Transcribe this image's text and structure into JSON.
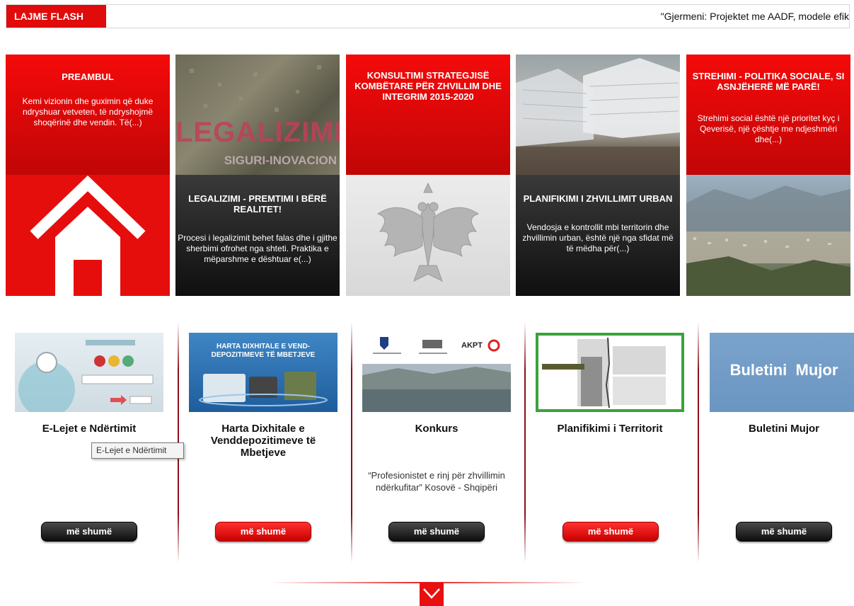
{
  "flash": {
    "label": "LAJME FLASH",
    "ticker": "\"Gjermeni: Projektet me AADF, modele efik"
  },
  "tiles": [
    {
      "title": "PREAMBUL",
      "text": "Kemi vizionin dhe guximin që duke ndryshuar vetveten, të ndryshojmë shoqërinë dhe vendin. Të(...)"
    },
    {
      "title": "LEGALIZIMI - PREMTIMI I BËRË REALITET!",
      "text": "Procesi i legalizimit behet falas dhe i gjithe sherbimi ofrohet nga shteti. Praktika e mëparshme e dështuar e(...)",
      "image_text": "LEGALIZIMI",
      "image_subtext": "SIGURI-INOVACION"
    },
    {
      "title": "KONSULTIMI STRATEGJISË KOMBËTARE PËR ZHVILLIM DHE INTEGRIM 2015-2020"
    },
    {
      "title": "PLANIFIKIMI I ZHVILLIMIT URBAN",
      "text": "Vendosja e kontrollit mbi territorin dhe zhvillimin urban, është një nga sfidat më të mëdha për(...)"
    },
    {
      "title": "STREHIMI - POLITIKA SOCIALE, SI ASNJËHERË MË PARË!",
      "text": "Strehimi social është një prioritet kyç i Qeverisë, një  çështje me ndjeshmëri dhe(...)"
    }
  ],
  "cards": [
    {
      "title": "E-Lejet e Ndërtimit",
      "text": "",
      "button": "më shumë"
    },
    {
      "title": "Harta Dixhitale e Venddepozitimeve të Mbetjeve",
      "text": "",
      "button": "më shumë",
      "image_text": "HARTA DIXHITALE E VEND-DEPOZITIMEVE TË MBETJEVE"
    },
    {
      "title": "Konkurs",
      "text": "“Profesionistet e rinj për zhvillimin ndërkufitar” Kosovë - Shqipëri",
      "button": "më shumë",
      "image_text": "AKPT"
    },
    {
      "title": "Planifikimi i Territorit",
      "text": "",
      "button": "më shumë"
    },
    {
      "title": "Buletini Mujor",
      "text": "",
      "button": "më shumë",
      "image_text": "Buletini  Mujor"
    }
  ],
  "tooltip": "E-Lejet e Ndërtimit",
  "colors": {
    "accent": "#e00b0b",
    "dark": "#111111",
    "divider": "#8b0f18"
  }
}
